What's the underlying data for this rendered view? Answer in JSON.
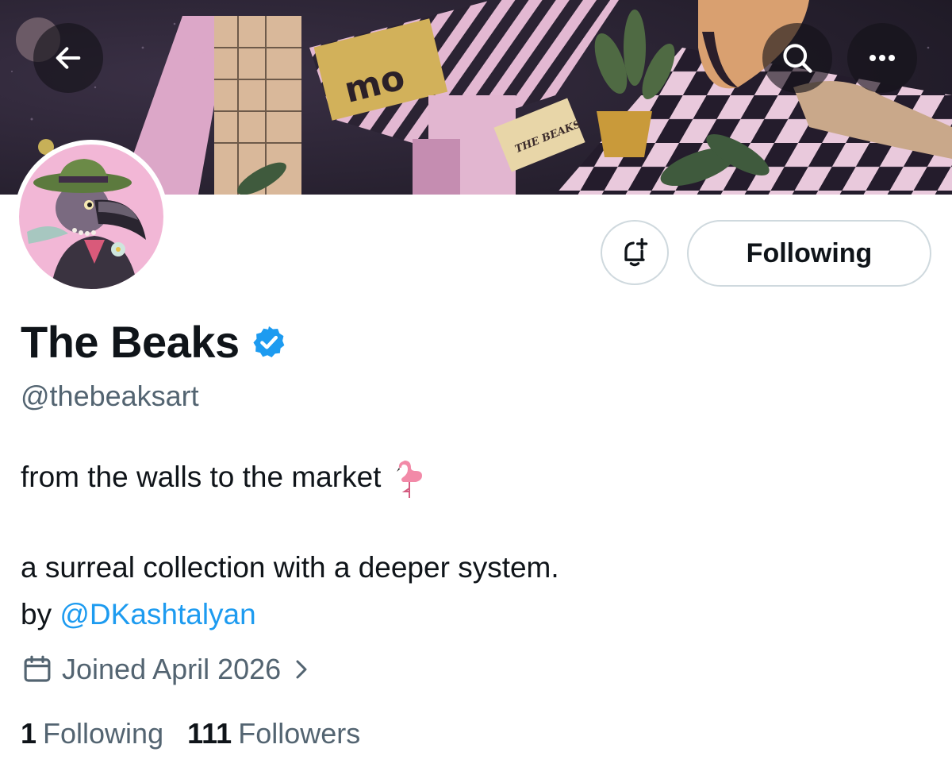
{
  "header": {
    "back_icon": "arrow-left-icon",
    "search_icon": "search-icon",
    "more_icon": "more-horizontal-icon",
    "banner_text": [
      "mo",
      "THE BEAKS"
    ]
  },
  "profile": {
    "display_name": "The Beaks",
    "verified": true,
    "handle": "@thebeaksart",
    "bio": {
      "line1": "from the walls to the market",
      "line1_emoji": "flamingo-emoji",
      "line2": "a surreal collection with a deeper system.",
      "line3_prefix": "by",
      "line3_mention": "@DKashtalyan"
    },
    "joined": "Joined April 2026",
    "following_count": "1",
    "following_label": "Following",
    "followers_count": "111",
    "followers_label": "Followers"
  },
  "actions": {
    "notify_icon": "bell-plus-icon",
    "follow_button_label": "Following"
  },
  "colors": {
    "text_primary": "#0f1419",
    "text_secondary": "#536471",
    "link": "#1d9bf0",
    "verified": "#1d9bf0",
    "button_border": "#cfd9de",
    "banner_pink": "#d9a6c8",
    "banner_dark": "#2a2336",
    "avatar_bg": "#f2b7d6"
  }
}
